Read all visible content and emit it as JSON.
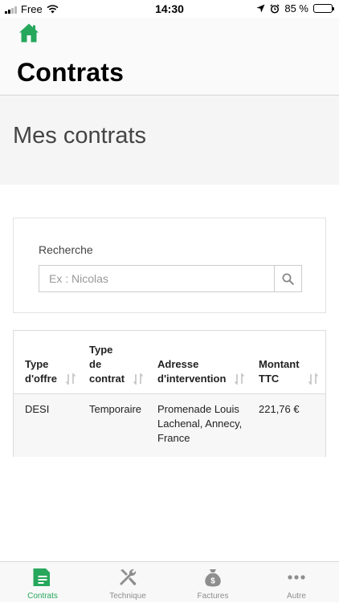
{
  "status_bar": {
    "carrier": "Free",
    "time": "14:30",
    "battery_percent": "85 %",
    "battery_level": 0.85
  },
  "header": {
    "title": "Contrats",
    "home_icon": "home-icon"
  },
  "section": {
    "title": "Mes contrats"
  },
  "search": {
    "label": "Recherche",
    "placeholder": "Ex : Nicolas",
    "value": "",
    "icon": "search-icon"
  },
  "table": {
    "columns": [
      {
        "line1": "Type",
        "line2": "d'offre",
        "line3": ""
      },
      {
        "line1": "Type",
        "line2": "de",
        "line3": "contrat"
      },
      {
        "line1": "Adresse",
        "line2": "d'intervention",
        "line3": ""
      },
      {
        "line1": "Montant",
        "line2": "TTC",
        "line3": ""
      }
    ],
    "rows": [
      {
        "type_offre": "DESI",
        "type_contrat": "Temporaire",
        "adresse_1": "Promenade Louis",
        "adresse_2": "Lachenal, Annecy,",
        "adresse_3": "France",
        "montant": "221,76 €"
      }
    ]
  },
  "tabs": [
    {
      "label": "Contrats",
      "icon": "contract-icon",
      "active": true
    },
    {
      "label": "Technique",
      "icon": "tools-icon",
      "active": false
    },
    {
      "label": "Factures",
      "icon": "money-bag-icon",
      "active": false
    },
    {
      "label": "Autre",
      "icon": "more-icon",
      "active": false
    }
  ],
  "colors": {
    "accent": "#27a75c",
    "inactive": "#8e8e8e"
  }
}
